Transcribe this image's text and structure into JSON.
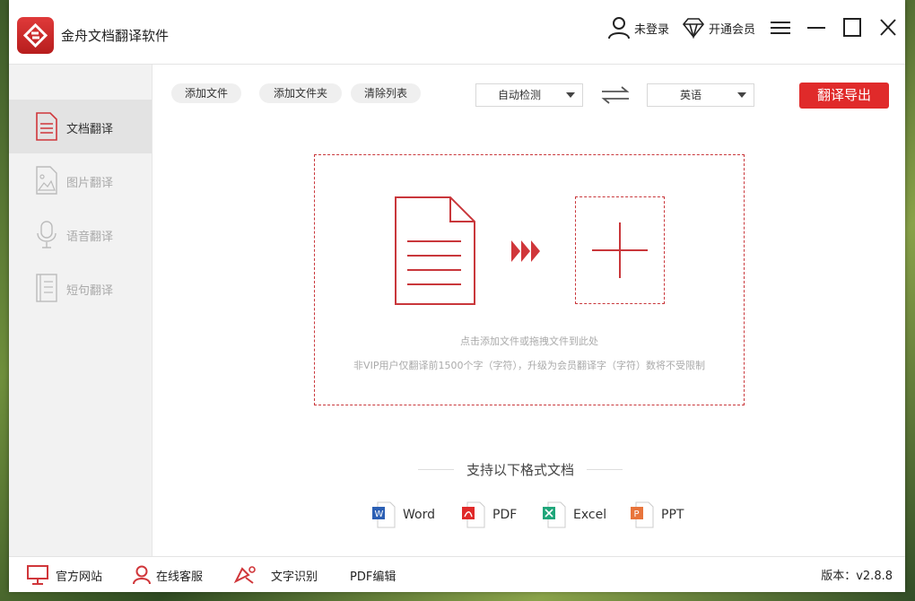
{
  "app": {
    "title": "金舟文档翻译软件"
  },
  "titlebar": {
    "login": "未登录",
    "vip": "开通会员"
  },
  "sidebar": {
    "items": [
      {
        "label": "文档翻译",
        "icon": "document-icon",
        "active": true
      },
      {
        "label": "图片翻译",
        "icon": "image-icon",
        "active": false
      },
      {
        "label": "语音翻译",
        "icon": "microphone-icon",
        "active": false
      },
      {
        "label": "短句翻译",
        "icon": "text-note-icon",
        "active": false
      }
    ]
  },
  "toolbar": {
    "add_file": "添加文件",
    "add_folder": "添加文件夹",
    "clear_list": "清除列表",
    "source_lang": "自动检测",
    "target_lang": "英语",
    "export": "翻译导出"
  },
  "dropzone": {
    "hint": "点击添加文件或拖拽文件到此处",
    "limit_note": "非VIP用户仅翻译前1500个字（字符），升级为会员翻译字（字符）数将不受限制"
  },
  "formats": {
    "title": "支持以下格式文档",
    "items": [
      {
        "label": "Word",
        "icon": "word-icon",
        "color": "#2b5fb4"
      },
      {
        "label": "PDF",
        "icon": "pdf-icon",
        "color": "#e02a2a"
      },
      {
        "label": "Excel",
        "icon": "excel-icon",
        "color": "#1fa67a"
      },
      {
        "label": "PPT",
        "icon": "ppt-icon",
        "color": "#e8743b"
      }
    ]
  },
  "bottombar": {
    "website": "官方网站",
    "support": "在线客服",
    "ocr": "文字识别",
    "pdf_edit": "PDF编辑",
    "version": "版本：v2.8.8"
  },
  "colors": {
    "accent": "#e02a2a",
    "sidebar_bg": "#f2f2f2"
  }
}
